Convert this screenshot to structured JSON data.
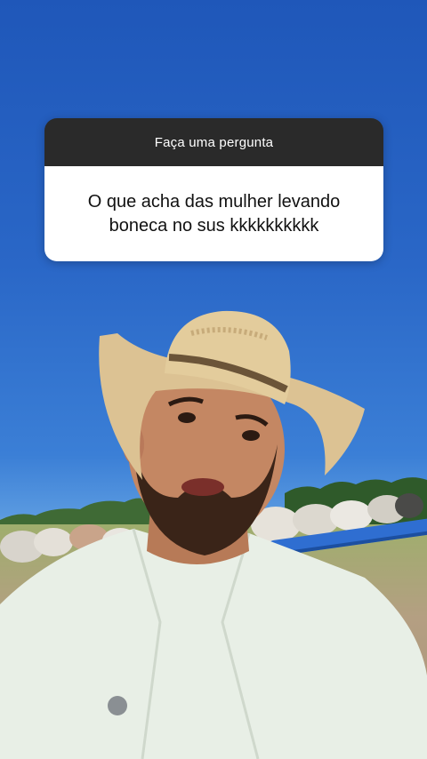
{
  "question_box": {
    "header": "Faça uma pergunta",
    "question": "O que acha das mulher levando boneca no sus kkkkkkkkkk"
  },
  "colors": {
    "sky": "#2a67c7",
    "card_header_bg": "#2a2a2a",
    "card_body_bg": "#ffffff",
    "hat": "#e0c89a",
    "shirt": "#e8efe6"
  },
  "icons": [
    "cowboy-hat-icon"
  ]
}
